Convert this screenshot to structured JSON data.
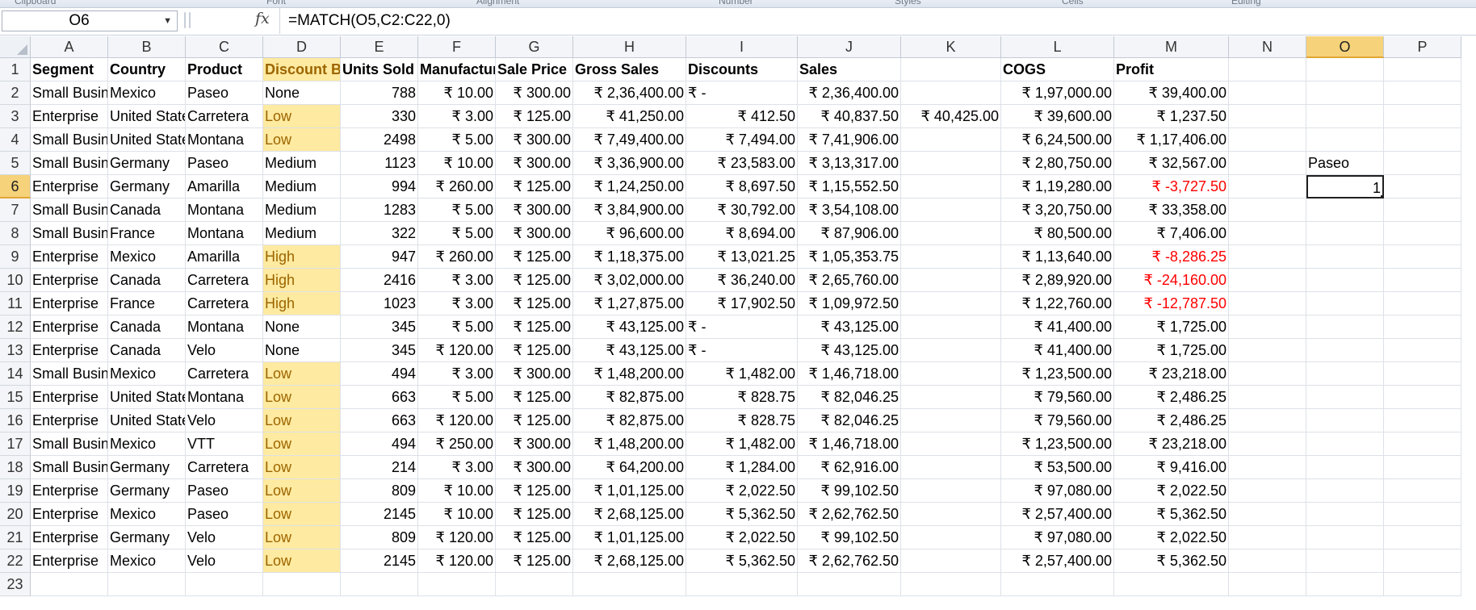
{
  "window": {
    "ribbon_group_labels": [
      "Clipboard",
      "Font",
      "Alignment",
      "Number",
      "Styles",
      "Cells",
      "Editing"
    ]
  },
  "formula_bar": {
    "name_box": "O6",
    "fx_label": "fx",
    "formula": "=MATCH(O5,C2:C22,0)"
  },
  "columns": [
    "A",
    "B",
    "C",
    "D",
    "E",
    "F",
    "G",
    "H",
    "I",
    "J",
    "K",
    "L",
    "M",
    "N",
    "O",
    "P"
  ],
  "rows": [
    "1",
    "2",
    "3",
    "4",
    "5",
    "6",
    "7",
    "8",
    "9",
    "10",
    "11",
    "12",
    "13",
    "14",
    "15",
    "16",
    "17",
    "18",
    "19",
    "20",
    "21",
    "22",
    "23"
  ],
  "headers": [
    "Segment",
    "Country",
    "Product",
    "Discount Band",
    "Units Sold",
    "Manufacturing Price",
    "Sale Price",
    "Gross Sales",
    "Discounts",
    "Sales",
    "",
    "COGS",
    "Profit"
  ],
  "table": [
    [
      "Small Business",
      "Mexico",
      "Paseo",
      "None",
      "788",
      "₹ 10.00",
      "₹ 300.00",
      "₹ 2,36,400.00",
      "₹ -",
      "₹ 2,36,400.00",
      "",
      "₹ 1,97,000.00",
      "₹ 39,400.00"
    ],
    [
      "Enterprise",
      "United States of America",
      "Carretera",
      "Low",
      "330",
      "₹ 3.00",
      "₹ 125.00",
      "₹ 41,250.00",
      "₹ 412.50",
      "₹ 40,837.50",
      "₹ 40,425.00",
      "₹ 39,600.00",
      "₹ 1,237.50"
    ],
    [
      "Small Business",
      "United States of America",
      "Montana",
      "Low",
      "2498",
      "₹ 5.00",
      "₹ 300.00",
      "₹ 7,49,400.00",
      "₹ 7,494.00",
      "₹ 7,41,906.00",
      "",
      "₹ 6,24,500.00",
      "₹ 1,17,406.00"
    ],
    [
      "Small Business",
      "Germany",
      "Paseo",
      "Medium",
      "1123",
      "₹ 10.00",
      "₹ 300.00",
      "₹ 3,36,900.00",
      "₹ 23,583.00",
      "₹ 3,13,317.00",
      "",
      "₹ 2,80,750.00",
      "₹ 32,567.00"
    ],
    [
      "Enterprise",
      "Germany",
      "Amarilla",
      "Medium",
      "994",
      "₹ 260.00",
      "₹ 125.00",
      "₹ 1,24,250.00",
      "₹ 8,697.50",
      "₹ 1,15,552.50",
      "",
      "₹ 1,19,280.00",
      "₹ -3,727.50"
    ],
    [
      "Small Business",
      "Canada",
      "Montana",
      "Medium",
      "1283",
      "₹ 5.00",
      "₹ 300.00",
      "₹ 3,84,900.00",
      "₹ 30,792.00",
      "₹ 3,54,108.00",
      "",
      "₹ 3,20,750.00",
      "₹ 33,358.00"
    ],
    [
      "Small Business",
      "France",
      "Montana",
      "Medium",
      "322",
      "₹ 5.00",
      "₹ 300.00",
      "₹ 96,600.00",
      "₹ 8,694.00",
      "₹ 87,906.00",
      "",
      "₹ 80,500.00",
      "₹ 7,406.00"
    ],
    [
      "Enterprise",
      "Mexico",
      "Amarilla",
      "High",
      "947",
      "₹ 260.00",
      "₹ 125.00",
      "₹ 1,18,375.00",
      "₹ 13,021.25",
      "₹ 1,05,353.75",
      "",
      "₹ 1,13,640.00",
      "₹ -8,286.25"
    ],
    [
      "Enterprise",
      "Canada",
      "Carretera",
      "High",
      "2416",
      "₹ 3.00",
      "₹ 125.00",
      "₹ 3,02,000.00",
      "₹ 36,240.00",
      "₹ 2,65,760.00",
      "",
      "₹ 2,89,920.00",
      "₹ -24,160.00"
    ],
    [
      "Enterprise",
      "France",
      "Carretera",
      "High",
      "1023",
      "₹ 3.00",
      "₹ 125.00",
      "₹ 1,27,875.00",
      "₹ 17,902.50",
      "₹ 1,09,972.50",
      "",
      "₹ 1,22,760.00",
      "₹ -12,787.50"
    ],
    [
      "Enterprise",
      "Canada",
      "Montana",
      "None",
      "345",
      "₹ 5.00",
      "₹ 125.00",
      "₹ 43,125.00",
      "₹ -",
      "₹ 43,125.00",
      "",
      "₹ 41,400.00",
      "₹ 1,725.00"
    ],
    [
      "Enterprise",
      "Canada",
      "Velo",
      "None",
      "345",
      "₹ 120.00",
      "₹ 125.00",
      "₹ 43,125.00",
      "₹ -",
      "₹ 43,125.00",
      "",
      "₹ 41,400.00",
      "₹ 1,725.00"
    ],
    [
      "Small Business",
      "Mexico",
      "Carretera",
      "Low",
      "494",
      "₹ 3.00",
      "₹ 300.00",
      "₹ 1,48,200.00",
      "₹ 1,482.00",
      "₹ 1,46,718.00",
      "",
      "₹ 1,23,500.00",
      "₹ 23,218.00"
    ],
    [
      "Enterprise",
      "United States of America",
      "Montana",
      "Low",
      "663",
      "₹ 5.00",
      "₹ 125.00",
      "₹ 82,875.00",
      "₹ 828.75",
      "₹ 82,046.25",
      "",
      "₹ 79,560.00",
      "₹ 2,486.25"
    ],
    [
      "Enterprise",
      "United States of America",
      "Velo",
      "Low",
      "663",
      "₹ 120.00",
      "₹ 125.00",
      "₹ 82,875.00",
      "₹ 828.75",
      "₹ 82,046.25",
      "",
      "₹ 79,560.00",
      "₹ 2,486.25"
    ],
    [
      "Small Business",
      "Mexico",
      "VTT",
      "Low",
      "494",
      "₹ 250.00",
      "₹ 300.00",
      "₹ 1,48,200.00",
      "₹ 1,482.00",
      "₹ 1,46,718.00",
      "",
      "₹ 1,23,500.00",
      "₹ 23,218.00"
    ],
    [
      "Small Business",
      "Germany",
      "Carretera",
      "Low",
      "214",
      "₹ 3.00",
      "₹ 300.00",
      "₹ 64,200.00",
      "₹ 1,284.00",
      "₹ 62,916.00",
      "",
      "₹ 53,500.00",
      "₹ 9,416.00"
    ],
    [
      "Enterprise",
      "Germany",
      "Paseo",
      "Low",
      "809",
      "₹ 10.00",
      "₹ 125.00",
      "₹ 1,01,125.00",
      "₹ 2,022.50",
      "₹ 99,102.50",
      "",
      "₹ 97,080.00",
      "₹ 2,022.50"
    ],
    [
      "Enterprise",
      "Mexico",
      "Paseo",
      "Low",
      "2145",
      "₹ 10.00",
      "₹ 125.00",
      "₹ 2,68,125.00",
      "₹ 5,362.50",
      "₹ 2,62,762.50",
      "",
      "₹ 2,57,400.00",
      "₹ 5,362.50"
    ],
    [
      "Enterprise",
      "Germany",
      "Velo",
      "Low",
      "809",
      "₹ 120.00",
      "₹ 125.00",
      "₹ 1,01,125.00",
      "₹ 2,022.50",
      "₹ 99,102.50",
      "",
      "₹ 97,080.00",
      "₹ 2,022.50"
    ],
    [
      "Enterprise",
      "Mexico",
      "Velo",
      "Low",
      "2145",
      "₹ 120.00",
      "₹ 125.00",
      "₹ 2,68,125.00",
      "₹ 5,362.50",
      "₹ 2,62,762.50",
      "",
      "₹ 2,57,400.00",
      "₹ 5,362.50"
    ]
  ],
  "extra_cells": {
    "O5": "Paseo",
    "O6": "1"
  },
  "colors": {
    "highlight_fill": "#feeaa0",
    "highlight_text": "#9c6500",
    "negative": "#ff0000",
    "selected_header": "#f6d27a"
  }
}
